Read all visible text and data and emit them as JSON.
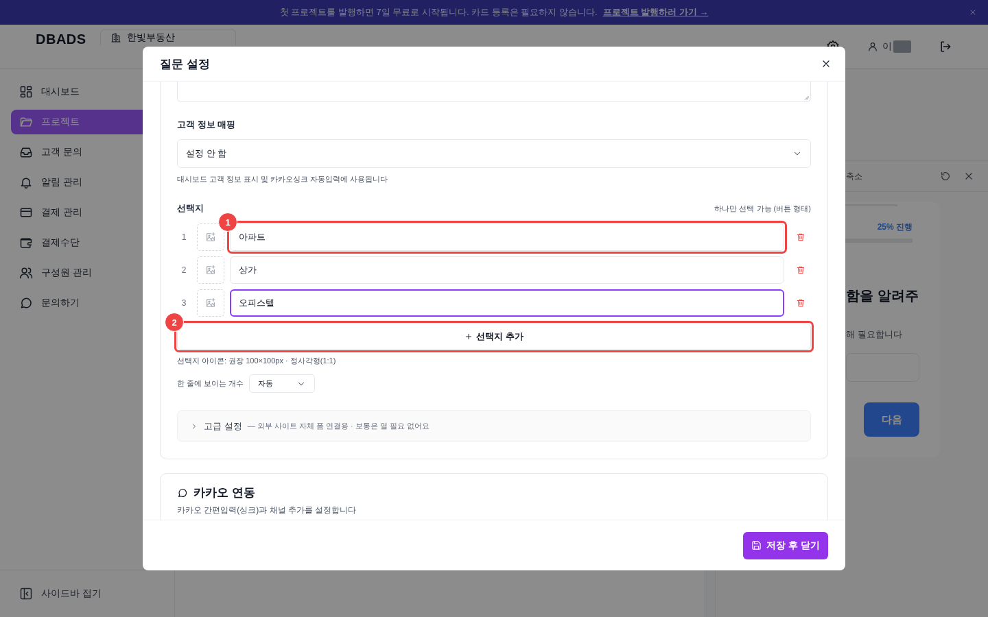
{
  "banner": {
    "text": "첫 프로젝트를 발행하면 7일 무료로 시작됩니다. 카드 등록은 필요하지 않습니다.",
    "link": "프로젝트 발행하러 가기 →"
  },
  "header": {
    "logo": "DBADS",
    "workspace": "한빛부동산",
    "user": "이"
  },
  "sidebar": {
    "items": [
      {
        "label": "대시보드",
        "kind": "grid",
        "selected": false
      },
      {
        "label": "프로젝트",
        "kind": "folder",
        "selected": true
      },
      {
        "label": "고객 문의",
        "kind": "inbox",
        "selected": false
      },
      {
        "label": "알림 관리",
        "kind": "bell",
        "selected": false
      },
      {
        "label": "결제 관리",
        "kind": "card",
        "selected": false
      },
      {
        "label": "결제수단",
        "kind": "wallet",
        "selected": false
      },
      {
        "label": "구성원 관리",
        "kind": "users",
        "selected": false
      },
      {
        "label": "문의하기",
        "kind": "chat",
        "selected": false
      }
    ],
    "collapse": "사이드바 접기"
  },
  "preview": {
    "collapse": "축소",
    "progress": "25% 진행",
    "question": "함을 알려주",
    "hint": "해 필요합니다",
    "next": "다음"
  },
  "modal": {
    "title": "질문 설정",
    "mapping": {
      "label": "고객 정보 매핑",
      "value": "설정 안 함",
      "help": "대시보드 고객 정보 표시 및 카카오싱크 자동입력에 사용됩니다"
    },
    "choices": {
      "label": "선택지",
      "mode": "하나만 선택 가능 (버튼 형태)",
      "items": [
        {
          "number": "1",
          "value": "아파트",
          "focused": false,
          "annotation": "1"
        },
        {
          "number": "2",
          "value": "상가",
          "focused": false
        },
        {
          "number": "3",
          "value": "오피스텔",
          "focused": true
        }
      ],
      "add": {
        "label": "선택지 추가",
        "annotation": "2"
      },
      "icon_hint": "선택지 아이콘: 권장 100×100px · 정사각형(1:1)",
      "per_row": {
        "label": "한 줄에 보이는 개수",
        "value": "자동"
      }
    },
    "advanced": {
      "title": "고급 설정",
      "note": "— 외부 사이트 자체 폼 연결용 · 보통은 열 필요 없어요",
      "expanded": false
    },
    "kakao": {
      "title": "카카오 연동",
      "desc": "카카오 간편입력(싱크)과 채널 추가를 설정합니다"
    },
    "save": "저장 후 닫기"
  }
}
